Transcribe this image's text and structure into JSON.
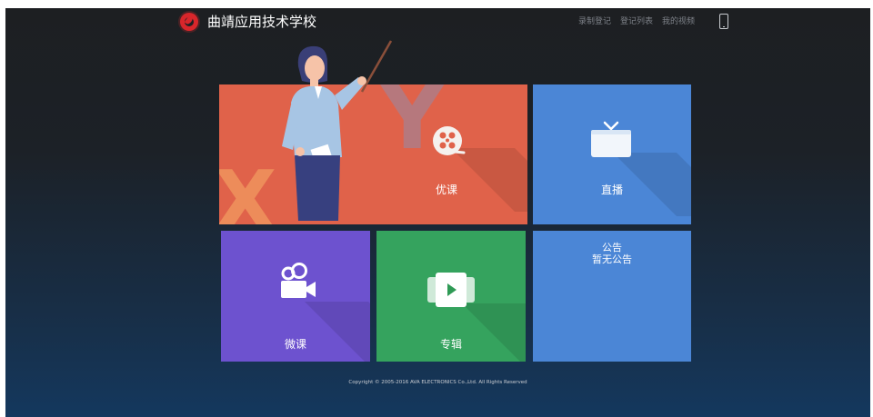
{
  "header": {
    "school_name": "曲靖应用技术学校",
    "links": [
      "录制登记",
      "登记列表",
      "我的视频"
    ]
  },
  "tiles": {
    "youke": {
      "label": "优课",
      "deco_letters": [
        "X",
        "Y"
      ]
    },
    "zhibo": {
      "label": "直播"
    },
    "weike": {
      "label": "微课"
    },
    "zhuanji": {
      "label": "专辑"
    },
    "notice": {
      "title": "公告",
      "body": "暂无公告"
    }
  },
  "footer": {
    "copyright": "Copyright © 2005-2016 AVA ELECTRONICS Co.,Ltd. All Rights Reserved"
  },
  "colors": {
    "youke": "#e0624a",
    "zhibo": "#4b86d6",
    "weike": "#6d52cf",
    "zhuanji": "#35a35e",
    "notice": "#4b86d6",
    "logo": "#d8262b"
  },
  "icons": {
    "logo": "school-logo",
    "phone": "mobile-phone-icon",
    "youke": "film-reel-icon",
    "zhibo": "tv-icon",
    "weike": "video-camera-icon",
    "zhuanji": "play-video-icon"
  }
}
